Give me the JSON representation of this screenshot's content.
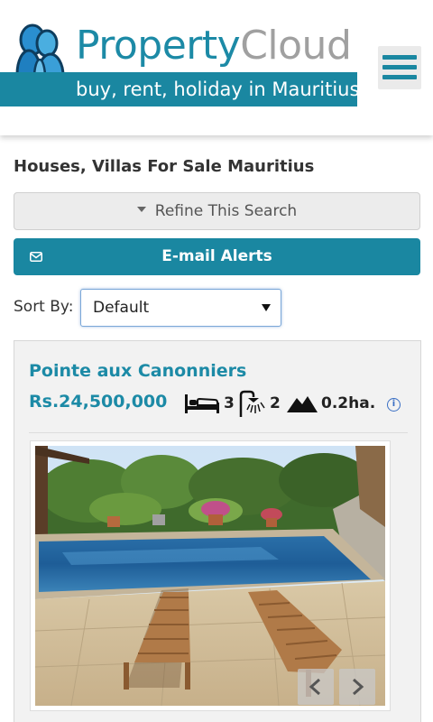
{
  "header": {
    "logo_title_part1": "Property",
    "logo_title_part2": "Cloud",
    "logo_tagline": "buy, rent, holiday in Mauritius",
    "menu_icon": "hamburger-menu-icon",
    "brand_color": "#1a87a1"
  },
  "page": {
    "title": "Houses, Villas For Sale Mauritius",
    "refine_label": "Refine This Search",
    "alerts_label": "E-mail Alerts"
  },
  "sort": {
    "label": "Sort By:",
    "selected": "Default"
  },
  "listing": {
    "title": "Pointe aux Canonniers",
    "price": "Rs.24,500,000",
    "bedrooms": "3",
    "bathrooms": "2",
    "land": "0.2ha.",
    "icons": [
      "bed-icon",
      "shower-icon",
      "land-icon",
      "info-icon"
    ]
  }
}
